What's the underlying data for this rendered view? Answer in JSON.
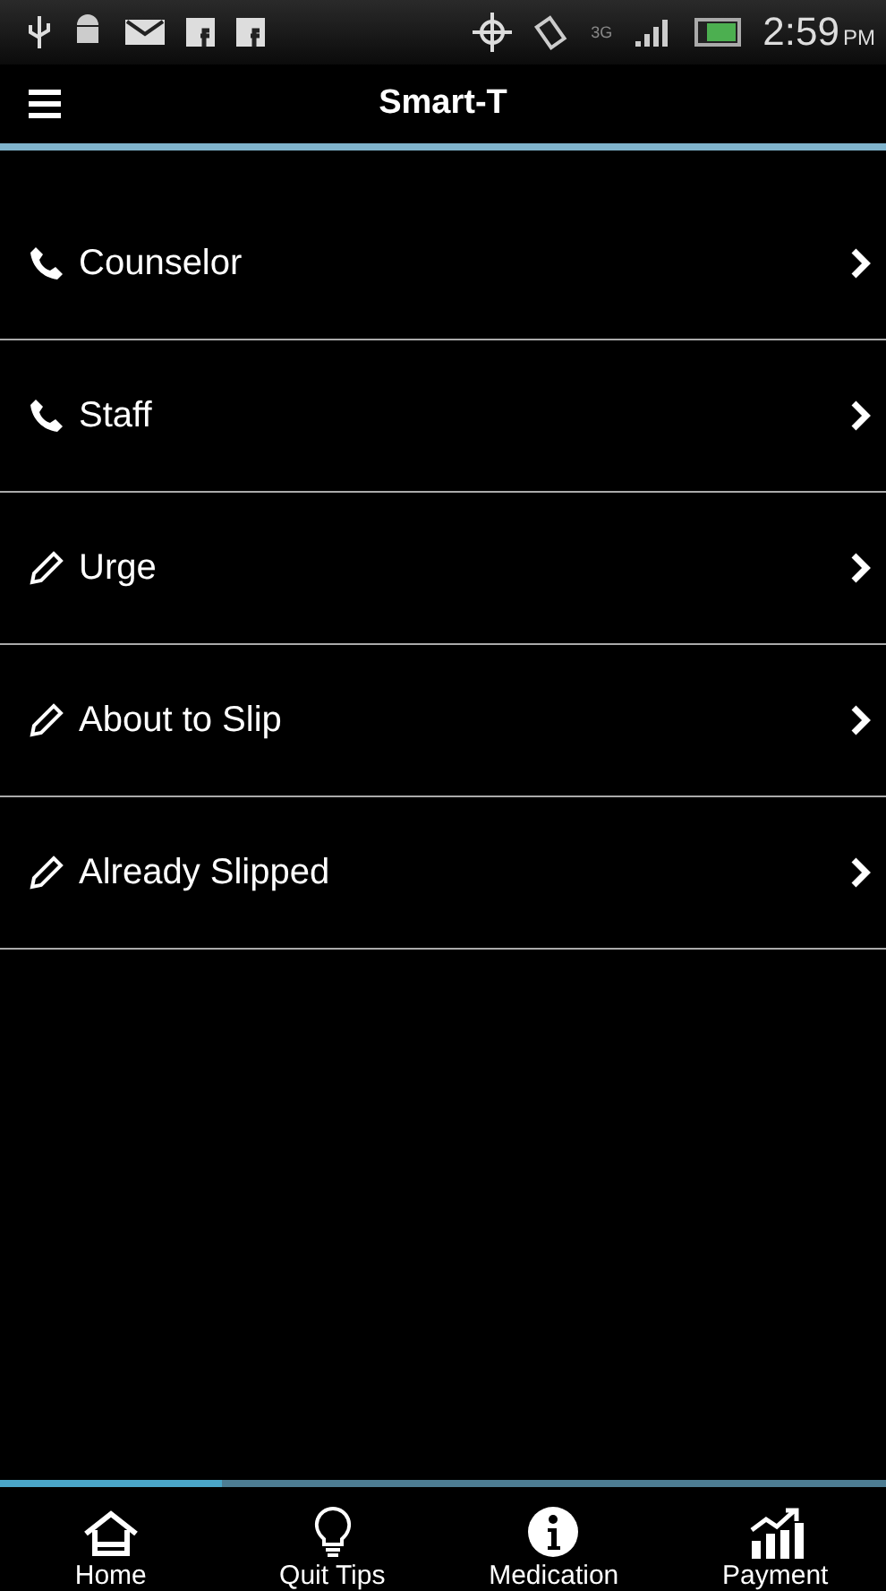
{
  "status_bar": {
    "network": "3G",
    "time": "2:59",
    "meridiem": "PM"
  },
  "header": {
    "title": "Smart-T"
  },
  "items": [
    {
      "label": "Counselor",
      "kind": "phone"
    },
    {
      "label": "Staff",
      "kind": "phone"
    },
    {
      "label": "Urge",
      "kind": "pencil"
    },
    {
      "label": "About to Slip",
      "kind": "pencil"
    },
    {
      "label": "Already Slipped",
      "kind": "pencil"
    }
  ],
  "tabs": [
    {
      "label": "Home",
      "kind": "home",
      "selected": true
    },
    {
      "label": "Quit Tips",
      "kind": "bulb",
      "selected": false
    },
    {
      "label": "Medication",
      "kind": "info",
      "selected": false
    },
    {
      "label": "Payment",
      "kind": "chart",
      "selected": false
    }
  ]
}
